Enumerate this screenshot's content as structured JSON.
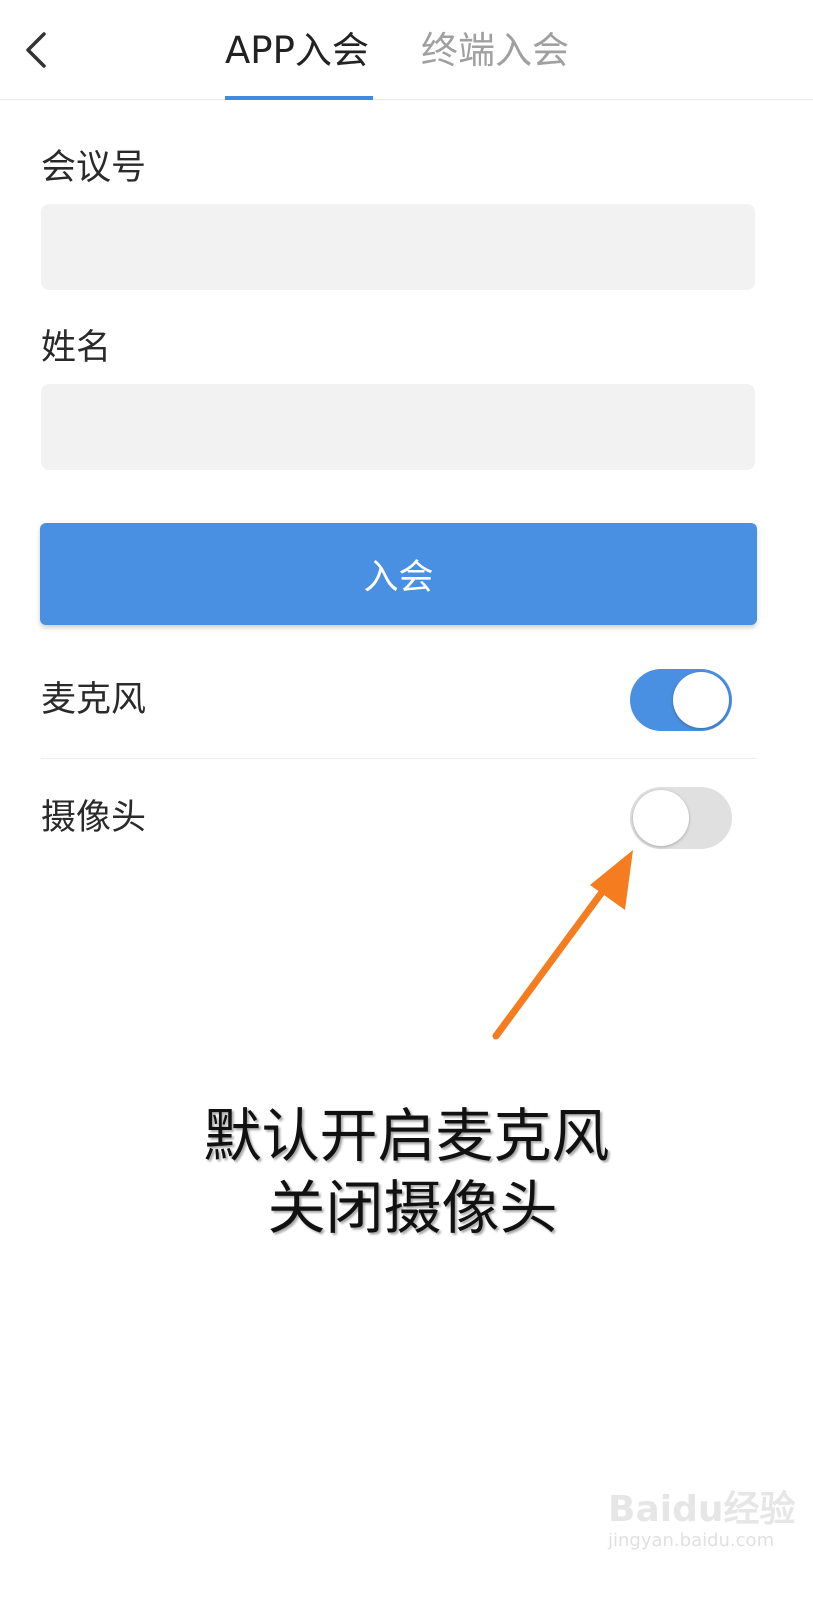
{
  "header": {
    "back_icon": "chevron-left-icon",
    "tabs": [
      {
        "label": "APP入会",
        "active": true
      },
      {
        "label": "终端入会",
        "active": false
      }
    ],
    "active_color": "#3e8be0"
  },
  "form": {
    "meeting_id_label": "会议号",
    "meeting_id_value": "",
    "name_label": "姓名",
    "name_value": "",
    "join_button": "入会",
    "button_color": "#4a90e2"
  },
  "options": {
    "microphone": {
      "label": "麦克风",
      "on": true
    },
    "camera": {
      "label": "摄像头",
      "on": false
    }
  },
  "annotation": {
    "line1": "默认开启麦克风",
    "line2": "关闭摄像头",
    "arrow_color": "#f57c1f"
  },
  "watermark": {
    "brand": "Baidu经验",
    "url": "jingyan.baidu.com"
  }
}
